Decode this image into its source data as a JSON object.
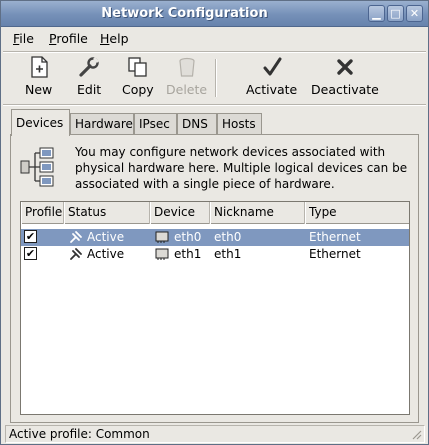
{
  "window": {
    "title": "Network Configuration",
    "controls": [
      "minimize",
      "maximize",
      "close"
    ]
  },
  "menu": [
    {
      "label": "File",
      "mnemonic": "F"
    },
    {
      "label": "Profile",
      "mnemonic": "P"
    },
    {
      "label": "Help",
      "mnemonic": "H"
    }
  ],
  "toolbar": {
    "new": "New",
    "edit": "Edit",
    "copy": "Copy",
    "delete": "Delete",
    "activate": "Activate",
    "deactivate": "Deactivate"
  },
  "tabs": [
    "Devices",
    "Hardware",
    "IPsec",
    "DNS",
    "Hosts"
  ],
  "active_tab": "Devices",
  "info_text": "You may configure network devices associated with physical hardware here.  Multiple logical devices can be associated with a single piece of hardware.",
  "table": {
    "columns": [
      "Profile",
      "Status",
      "Device",
      "Nickname",
      "Type"
    ],
    "rows": [
      {
        "profile_checked": true,
        "status": "Active",
        "device": "eth0",
        "nickname": "eth0",
        "type": "Ethernet",
        "selected": true
      },
      {
        "profile_checked": true,
        "status": "Active",
        "device": "eth1",
        "nickname": "eth1",
        "type": "Ethernet",
        "selected": false
      }
    ]
  },
  "status_bar": "Active profile: Common",
  "colors": {
    "titlebar": "#7590b8",
    "selection": "#7f98bf",
    "window_bg": "#eae8e3"
  }
}
